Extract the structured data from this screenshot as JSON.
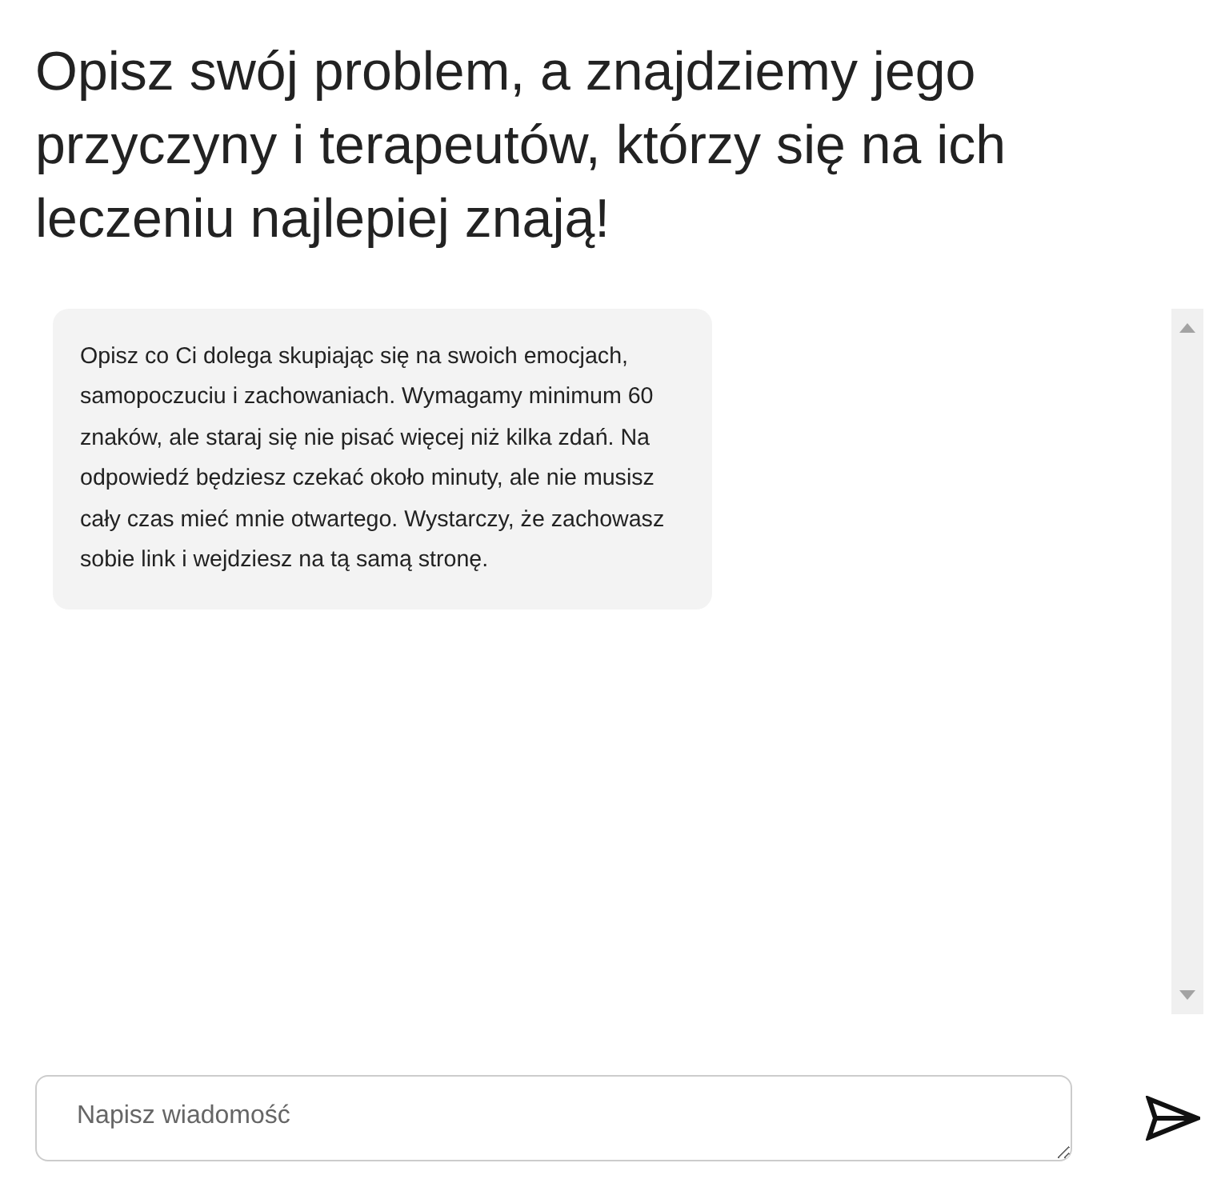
{
  "heading": "Opisz swój problem, a znajdziemy jego przyczyny i terapeutów, którzy się na ich leczeniu najlepiej znają!",
  "messages": [
    {
      "kind": "assistant",
      "text": "Opisz co Ci dolega skupiając się na swoich emocjach, samopoczuciu i zachowaniach. Wymagamy minimum 60 znaków, ale staraj się nie pisać więcej niż kilka zdań. Na odpowiedź będziesz czekać około minuty, ale nie musisz cały czas mieć mnie otwartego. Wystarczy, że zachowasz sobie link i wejdziesz na tą samą stronę."
    }
  ],
  "composer": {
    "placeholder": "Napisz wiadomość"
  }
}
